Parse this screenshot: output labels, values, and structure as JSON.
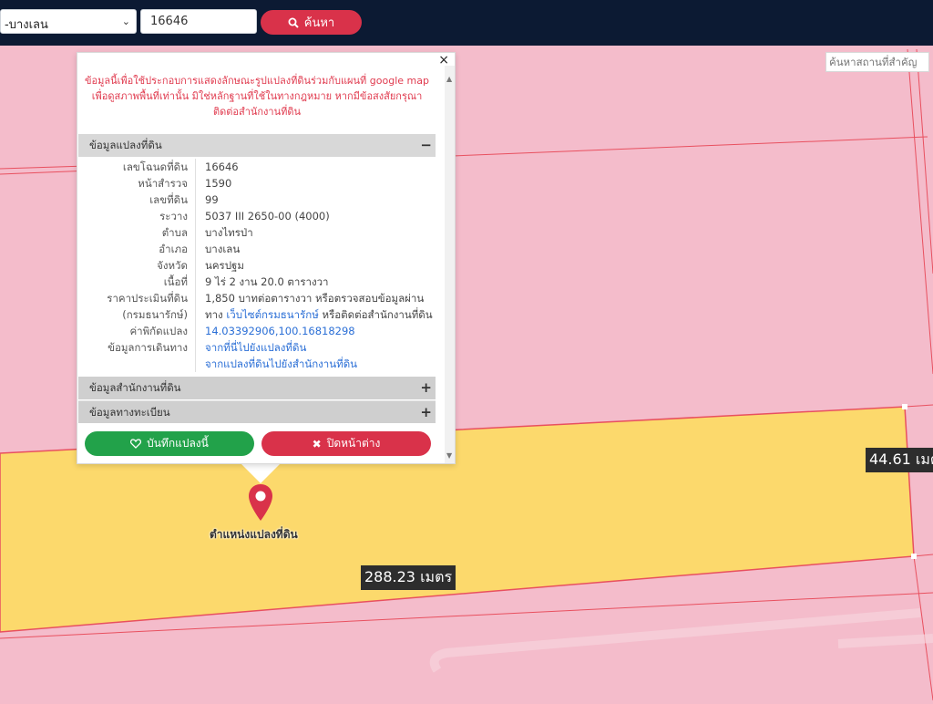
{
  "toolbar": {
    "district_value": "-บางเลน",
    "deed_value": "16646",
    "search_label": "ค้นหา"
  },
  "map": {
    "place_search_placeholder": "ค้นหาสถานที่สำคัญ",
    "measurements": {
      "side": "44.61 เมต",
      "bottom": "288.23 เมตร"
    },
    "marker_label": "ตำแหน่งแปลงที่ดิน",
    "colors": {
      "parcel_fill": "#fcd96c",
      "background_parcels": "#f4bccb",
      "parcel_lines": "#e8505f",
      "marker": "#d9324a"
    }
  },
  "popup": {
    "close_symbol": "×",
    "note": "ข้อมูลนี้เพื่อใช้ประกอบการแสดงลักษณะรูปแปลงที่ดินร่วมกับแผนที่ google map เพื่อดูสภาพพื้นที่เท่านั้น มิใช่หลักฐานที่ใช้ในทางกฎหมาย หากมีข้อสงสัยกรุณาติดต่อสำนักงานที่ดิน",
    "sections": {
      "parcel": {
        "title": "ข้อมูลแปลงที่ดิน",
        "sign": "−"
      },
      "office": {
        "title": "ข้อมูลสำนักงานที่ดิน",
        "sign": "+"
      },
      "registry": {
        "title": "ข้อมูลทางทะเบียน",
        "sign": "+"
      }
    },
    "fields": [
      {
        "label": "เลขโฉนดที่ดิน",
        "value": "16646"
      },
      {
        "label": "หน้าสำรวจ",
        "value": "1590"
      },
      {
        "label": "เลขที่ดิน",
        "value": "99"
      },
      {
        "label": "ระวาง",
        "value": "5037 III 2650-00 (4000)"
      },
      {
        "label": "ตำบล",
        "value": "บางไทรป่า"
      },
      {
        "label": "อำเภอ",
        "value": "บางเลน"
      },
      {
        "label": "จังหวัด",
        "value": "นครปฐม"
      },
      {
        "label": "เนื้อที่",
        "value": "9 ไร่ 2 งาน 20.0 ตารางวา"
      }
    ],
    "price": {
      "label1": "ราคาประเมินที่ดิน",
      "label2": "(กรมธนารักษ์)",
      "line1": "1,850 บาทต่อตารางวา หรือตรวจสอบข้อมูลผ่าน",
      "line2_pre": "ทาง",
      "line2_link": "เว็บไซต์กรมธนารักษ์",
      "line2_post": "หรือติดต่อสำนักงานที่ดิน"
    },
    "coords": {
      "label": "ค่าพิกัดแปลง",
      "value": "14.03392906,100.16818298"
    },
    "directions": {
      "label": "ข้อมูลการเดินทาง",
      "link1": "จากที่นี่ไปยังแปลงที่ดิน",
      "link2": "จากแปลงที่ดินไปยังสำนักงานที่ดิน"
    },
    "save_label": "บันทึกแปลงนี้",
    "close_label": "ปิดหน้าต่าง"
  }
}
